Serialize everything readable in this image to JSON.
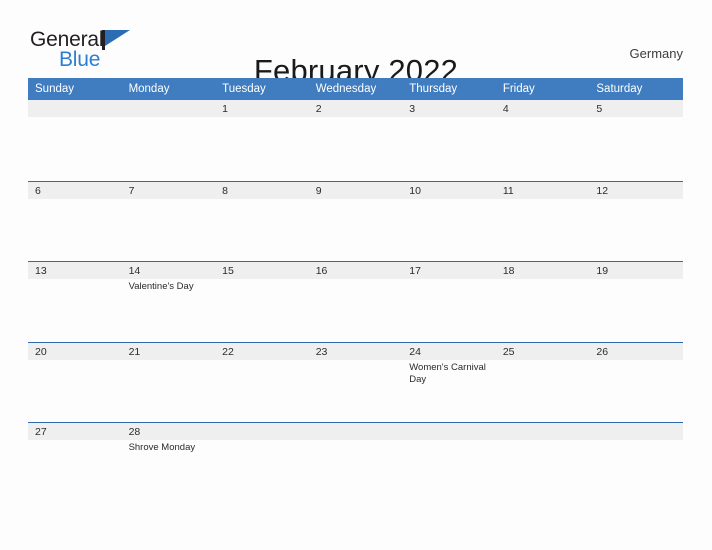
{
  "brand": {
    "word_general": "General",
    "word_blue": "Blue",
    "flag_icon": "flag-icon",
    "flag_color": "#2b6cb3"
  },
  "header": {
    "title": "February 2022",
    "country": "Germany"
  },
  "theme": {
    "header_blue": "#3f7cc0",
    "row_border_blue": "#2e6aad",
    "day_band_gray": "#efefef",
    "page_background": "#fdfdfd",
    "text_color": "#2b2b2b"
  },
  "calendar": {
    "month": "February",
    "year": "2022",
    "weekdays": [
      "Sunday",
      "Monday",
      "Tuesday",
      "Wednesday",
      "Thursday",
      "Friday",
      "Saturday"
    ],
    "weeks": [
      [
        {
          "date": "",
          "events": []
        },
        {
          "date": "",
          "events": []
        },
        {
          "date": "1",
          "events": []
        },
        {
          "date": "2",
          "events": []
        },
        {
          "date": "3",
          "events": []
        },
        {
          "date": "4",
          "events": []
        },
        {
          "date": "5",
          "events": []
        }
      ],
      [
        {
          "date": "6",
          "events": []
        },
        {
          "date": "7",
          "events": []
        },
        {
          "date": "8",
          "events": []
        },
        {
          "date": "9",
          "events": []
        },
        {
          "date": "10",
          "events": []
        },
        {
          "date": "11",
          "events": []
        },
        {
          "date": "12",
          "events": []
        }
      ],
      [
        {
          "date": "13",
          "events": []
        },
        {
          "date": "14",
          "events": [
            "Valentine's Day"
          ]
        },
        {
          "date": "15",
          "events": []
        },
        {
          "date": "16",
          "events": []
        },
        {
          "date": "17",
          "events": []
        },
        {
          "date": "18",
          "events": []
        },
        {
          "date": "19",
          "events": []
        }
      ],
      [
        {
          "date": "20",
          "events": []
        },
        {
          "date": "21",
          "events": []
        },
        {
          "date": "22",
          "events": []
        },
        {
          "date": "23",
          "events": []
        },
        {
          "date": "24",
          "events": [
            "Women's Carnival Day"
          ]
        },
        {
          "date": "25",
          "events": []
        },
        {
          "date": "26",
          "events": []
        }
      ],
      [
        {
          "date": "27",
          "events": []
        },
        {
          "date": "28",
          "events": [
            "Shrove Monday"
          ]
        },
        {
          "date": "",
          "events": []
        },
        {
          "date": "",
          "events": []
        },
        {
          "date": "",
          "events": []
        },
        {
          "date": "",
          "events": []
        },
        {
          "date": "",
          "events": []
        }
      ]
    ]
  }
}
